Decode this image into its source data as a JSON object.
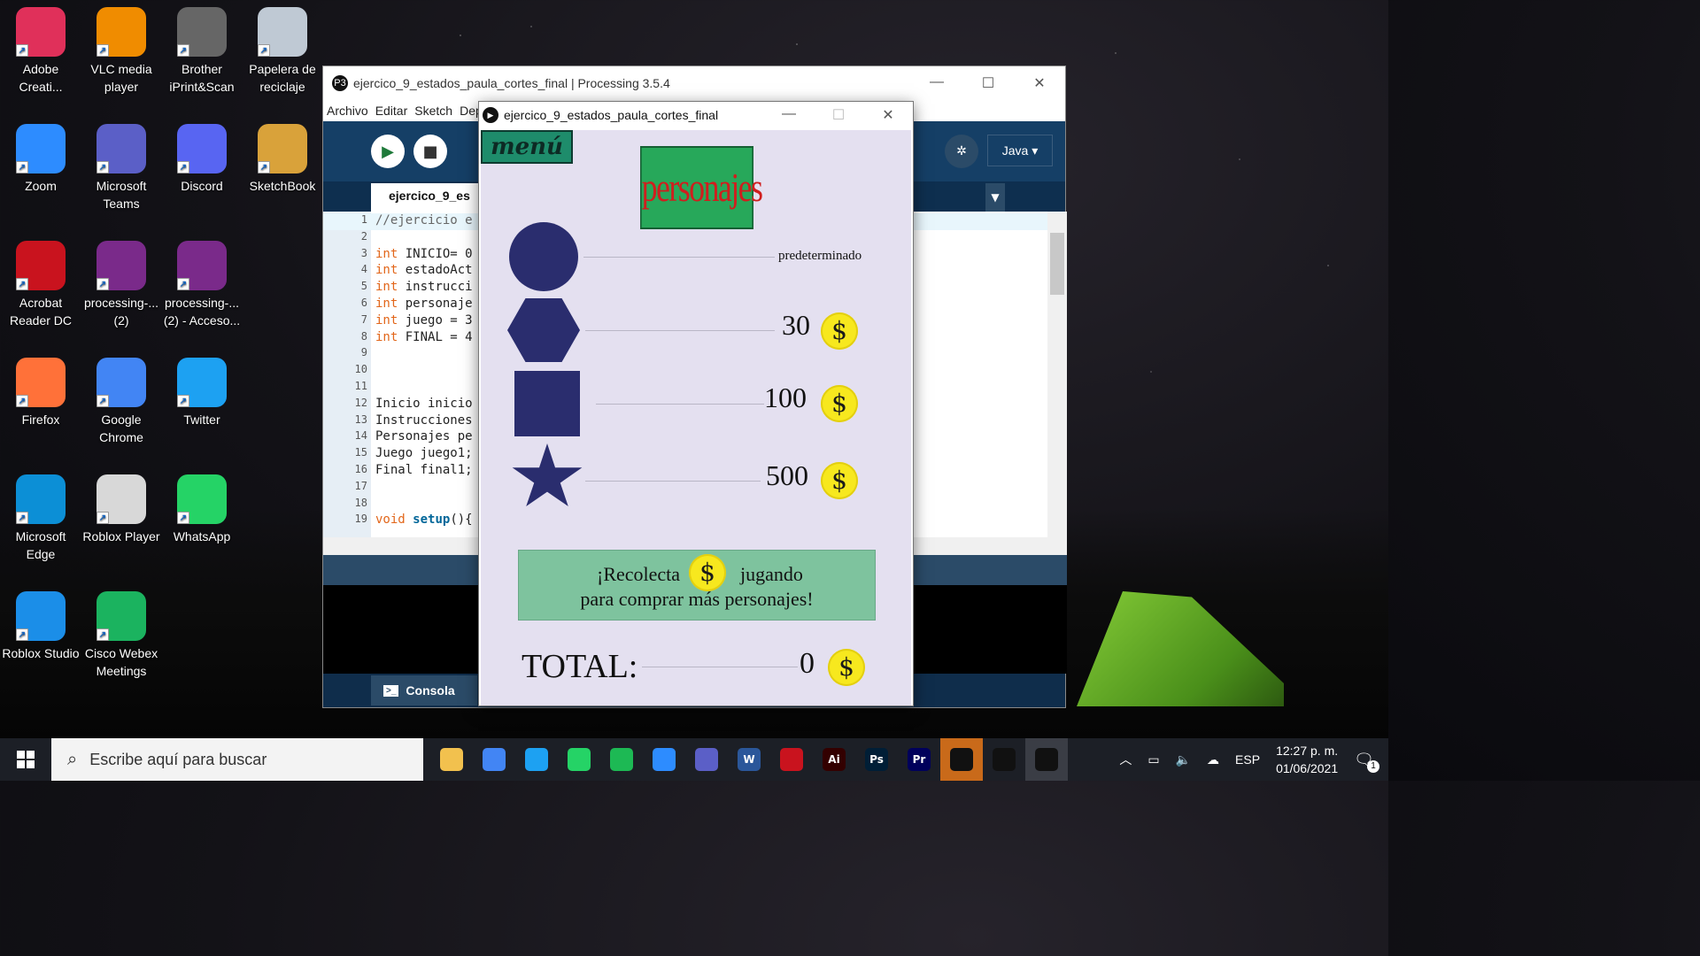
{
  "desktop_icons": [
    {
      "label": "Adobe Creati...",
      "icon": "adobe-cc-icon",
      "color": "#e0305a"
    },
    {
      "label": "VLC media player",
      "icon": "vlc-icon",
      "color": "#f08c00"
    },
    {
      "label": "Brother iPrint&Scan",
      "icon": "scanner-icon",
      "color": "#666666"
    },
    {
      "label": "Papelera de reciclaje",
      "icon": "recycle-bin-icon",
      "color": "#bfc9d4"
    },
    {
      "label": "Zoom",
      "icon": "zoom-icon",
      "color": "#2d8cff"
    },
    {
      "label": "Microsoft Teams",
      "icon": "teams-icon",
      "color": "#5b5fc7"
    },
    {
      "label": "Discord",
      "icon": "discord-icon",
      "color": "#5865f2"
    },
    {
      "label": "SketchBook",
      "icon": "sketchbook-icon",
      "color": "#d9a23a"
    },
    {
      "label": "Acrobat Reader DC",
      "icon": "acrobat-icon",
      "color": "#c9131e"
    },
    {
      "label": "processing-... (2)",
      "icon": "winrar-icon",
      "color": "#7a2a8a"
    },
    {
      "label": "processing-... (2) - Acceso...",
      "icon": "winrar-icon",
      "color": "#7a2a8a"
    },
    {
      "label": "Firefox",
      "icon": "firefox-icon",
      "color": "#ff7139"
    },
    {
      "label": "Google Chrome",
      "icon": "chrome-icon",
      "color": "#4285f4"
    },
    {
      "label": "Twitter",
      "icon": "twitter-icon",
      "color": "#1da1f2"
    },
    {
      "label": "Microsoft Edge",
      "icon": "edge-icon",
      "color": "#0c8fd6"
    },
    {
      "label": "Roblox Player",
      "icon": "roblox-icon",
      "color": "#d8d8d8"
    },
    {
      "label": "WhatsApp",
      "icon": "whatsapp-icon",
      "color": "#25d366"
    },
    {
      "label": "Roblox Studio",
      "icon": "roblox-studio-icon",
      "color": "#1b8ee8"
    },
    {
      "label": "Cisco Webex Meetings",
      "icon": "webex-icon",
      "color": "#1bb35f"
    }
  ],
  "ide": {
    "title": "ejercico_9_estados_paula_cortes_final | Processing 3.5.4",
    "menu": [
      "Archivo",
      "Editar",
      "Sketch",
      "Dep"
    ],
    "tab": "ejercico_9_es",
    "mode": "Java ▾",
    "code_lines": [
      {
        "n": "1",
        "text": "//ejercicio e"
      },
      {
        "n": "2",
        "text": ""
      },
      {
        "n": "3",
        "kw": "int",
        "text": " INICIO= 0"
      },
      {
        "n": "4",
        "kw": "int",
        "text": " estadoAct"
      },
      {
        "n": "5",
        "kw": "int",
        "text": " instrucci"
      },
      {
        "n": "6",
        "kw": "int",
        "text": " personaje"
      },
      {
        "n": "7",
        "kw": "int",
        "text": " juego = 3"
      },
      {
        "n": "8",
        "kw": "int",
        "text": " FINAL = 4"
      },
      {
        "n": "9",
        "text": ""
      },
      {
        "n": "10",
        "text": ""
      },
      {
        "n": "11",
        "text": ""
      },
      {
        "n": "12",
        "text": "Inicio inicio"
      },
      {
        "n": "13",
        "text": "Instrucciones"
      },
      {
        "n": "14",
        "text": "Personajes pe"
      },
      {
        "n": "15",
        "text": "Juego juego1;"
      },
      {
        "n": "16",
        "text": "Final final1;"
      },
      {
        "n": "17",
        "text": ""
      },
      {
        "n": "18",
        "text": ""
      },
      {
        "n": "19",
        "kw": "void",
        "fn": "setup",
        "text": "(){"
      }
    ],
    "console_tab": "Consola"
  },
  "sketch": {
    "window_title": "ejercico_9_estados_paula_cortes_final",
    "menu_button": "menú",
    "title": "personajes",
    "items": [
      {
        "shape": "circle",
        "price": "predeterminado",
        "coin": false
      },
      {
        "shape": "hexagon",
        "price": "30",
        "coin": true
      },
      {
        "shape": "square",
        "price": "100",
        "coin": true
      },
      {
        "shape": "star",
        "price": "500",
        "coin": true
      }
    ],
    "coin_symbol": "$",
    "banner_line1_a": "¡Recolecta",
    "banner_line1_b": "jugando",
    "banner_line2": "para comprar más personajes!",
    "total_label": "TOTAL:",
    "total_value": "0",
    "shape_color": "#2a2d6e",
    "coin_color": "#f7e81e"
  },
  "taskbar": {
    "search_placeholder": "Escribe aquí para buscar",
    "apps": [
      {
        "icon": "file-explorer-icon",
        "label": "",
        "color": "#f2c14e"
      },
      {
        "icon": "chrome-icon",
        "label": "",
        "color": "#4285f4"
      },
      {
        "icon": "twitter-icon",
        "label": "",
        "color": "#1da1f2"
      },
      {
        "icon": "whatsapp-icon",
        "label": "",
        "color": "#25d366"
      },
      {
        "icon": "spotify-icon",
        "label": "",
        "color": "#1db954"
      },
      {
        "icon": "zoom-icon",
        "label": "",
        "color": "#2d8cff"
      },
      {
        "icon": "teams-icon",
        "label": "",
        "color": "#5b5fc7"
      },
      {
        "icon": "word-icon",
        "label": "W",
        "color": "#2b579a"
      },
      {
        "icon": "acrobat-icon",
        "label": "",
        "color": "#c9131e"
      },
      {
        "icon": "illustrator-icon",
        "label": "Ai",
        "color": "#330000"
      },
      {
        "icon": "photoshop-icon",
        "label": "Ps",
        "color": "#001e36"
      },
      {
        "icon": "premiere-icon",
        "label": "Pr",
        "color": "#00005b"
      },
      {
        "icon": "processing-icon",
        "label": "",
        "color": "#111111"
      },
      {
        "icon": "processing-icon",
        "label": "",
        "color": "#111111"
      },
      {
        "icon": "sketch-play-icon",
        "label": "",
        "color": "#111111"
      }
    ],
    "language": "ESP",
    "time": "12:27 p. m.",
    "date": "01/06/2021",
    "notifications": "1"
  }
}
